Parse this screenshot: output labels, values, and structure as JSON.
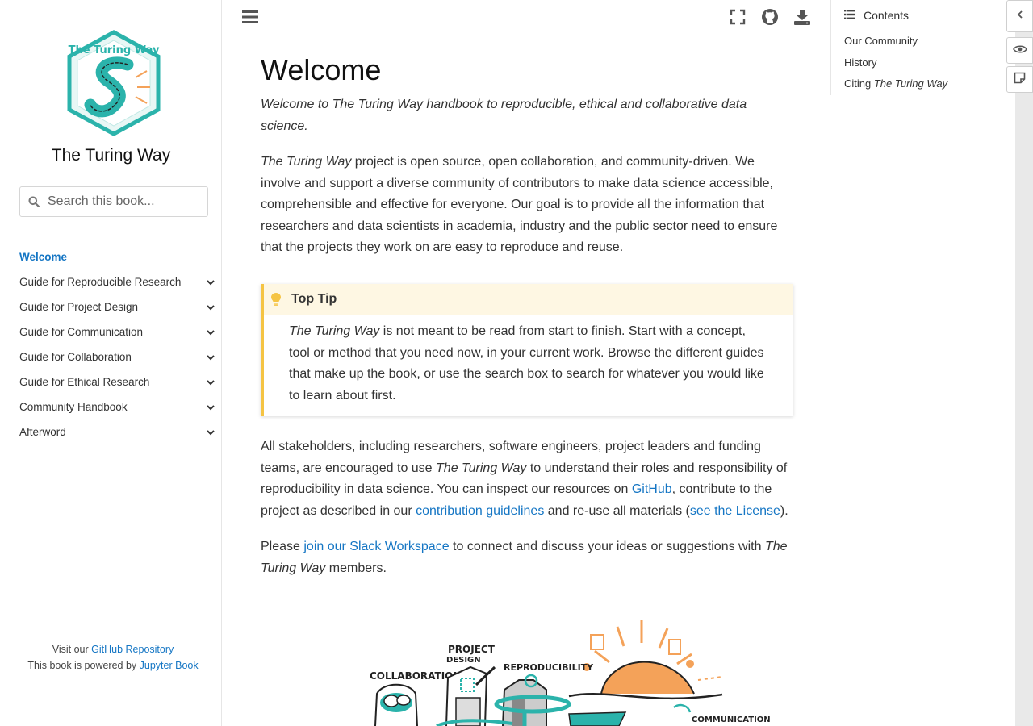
{
  "sidebar": {
    "site_title": "The Turing Way",
    "logo_text": "The Turing Way",
    "search_placeholder": "Search this book...",
    "nav": [
      {
        "label": "Welcome",
        "active": true,
        "expandable": false
      },
      {
        "label": "Guide for Reproducible Research",
        "active": false,
        "expandable": true
      },
      {
        "label": "Guide for Project Design",
        "active": false,
        "expandable": true
      },
      {
        "label": "Guide for Communication",
        "active": false,
        "expandable": true
      },
      {
        "label": "Guide for Collaboration",
        "active": false,
        "expandable": true
      },
      {
        "label": "Guide for Ethical Research",
        "active": false,
        "expandable": true
      },
      {
        "label": "Community Handbook",
        "active": false,
        "expandable": true
      },
      {
        "label": "Afterword",
        "active": false,
        "expandable": true
      }
    ],
    "footer": {
      "visit_prefix": "Visit our ",
      "repo_link": "GitHub Repository",
      "powered_prefix": "This book is powered by ",
      "jupyter_link": "Jupyter Book"
    }
  },
  "toolbar": {
    "icons": [
      "menu-icon",
      "fullscreen-icon",
      "github-icon",
      "download-icon"
    ]
  },
  "main": {
    "title": "Welcome",
    "intro": "Welcome to The Turing Way handbook to reproducible, ethical and collaborative data science.",
    "p2_em": "The Turing Way",
    "p2_rest": " project is open source, open collaboration, and community-driven. We involve and support a diverse community of contributors to make data science accessible, comprehensible and effective for everyone. Our goal is to provide all the information that researchers and data scientists in academia, industry and the public sector need to ensure that the projects they work on are easy to reproduce and reuse.",
    "tip": {
      "title": "Top Tip",
      "em": "The Turing Way",
      "rest": " is not meant to be read from start to finish. Start with a concept, tool or method that you need now, in your current work. Browse the different guides that make up the book, or use the search box to search for whatever you would like to learn about first."
    },
    "p3": {
      "a": "All stakeholders, including researchers, software engineers, project leaders and funding teams, are encouraged to use ",
      "em": "The Turing Way",
      "b": " to understand their roles and responsibility of reproducibility in data science. You can inspect our resources on ",
      "github_link": "GitHub",
      "c": ", contribute to the project as described in our ",
      "contrib_link": "contribution guidelines",
      "d": " and re-use all materials (",
      "license_link": "see the License",
      "e": ")."
    },
    "p4": {
      "a": "Please ",
      "slack_link": "join our Slack Workspace",
      "b": " to connect and discuss your ideas or suggestions with ",
      "em": "The Turing Way",
      "c": " members."
    },
    "illustration_labels": {
      "collab": "COLLABORATION",
      "project": "PROJECT",
      "design": "DESIGN",
      "repro": "REPRODUCIBILITY",
      "comm": "COMMUNICATION"
    }
  },
  "toc": {
    "heading": "Contents",
    "items": [
      {
        "label": "Our Community",
        "em": ""
      },
      {
        "label": "History",
        "em": ""
      },
      {
        "label": "Citing ",
        "em": "The Turing Way"
      }
    ]
  },
  "colors": {
    "link": "#1576c4",
    "tip_border": "#f5c443",
    "tip_bg": "#fef7e3",
    "teal": "#2bb3ab",
    "orange": "#f4a259"
  }
}
